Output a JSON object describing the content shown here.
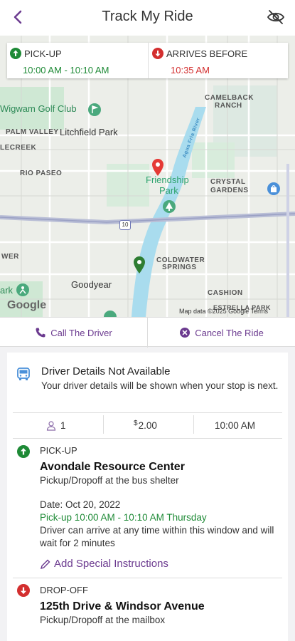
{
  "header": {
    "title": "Track My Ride"
  },
  "map": {
    "labels": {
      "wigwam": "Wigwam Golf Club",
      "palm_valley": "PALM VALLEY",
      "litchfield": "Litchfield Park",
      "lecreek": "LECREEK",
      "rio_paseo": "RIO PASEO",
      "camelback": "CAMELBACK",
      "ranch": "RANCH",
      "friendship": "Friendship",
      "park": "Park",
      "crystal": "CRYSTAL",
      "gardens": "GARDENS",
      "coldwater": "COLDWATER",
      "springs": "SPRINGS",
      "goodyear": "Goodyear",
      "cashion": "CASHION",
      "estrella": "ESTRELLA PARK",
      "wer": "WER",
      "ark": "ark",
      "agua_fria": "Agua Fria River",
      "i10": "10"
    },
    "google": "Google",
    "attribution": "Map data ©2025 Google   Terms"
  },
  "pickup_info": {
    "label": "PICK-UP",
    "value": "10:00 AM - 10:10 AM",
    "color": "#1e8a36"
  },
  "arrives_info": {
    "label": "ARRIVES BEFORE",
    "value": "10:35 AM",
    "color": "#d32f2f"
  },
  "actions": {
    "call": "Call The Driver",
    "cancel": "Cancel The Ride",
    "accent": "#6b3a8f"
  },
  "driver": {
    "title": "Driver Details Not Available",
    "subtitle": "Your driver details will be shown when your stop is next."
  },
  "stats": {
    "passengers": "1",
    "fare_symbol": "$",
    "fare": "2.00",
    "time": "10:00 AM"
  },
  "pickup": {
    "type": "PICK-UP",
    "name": "Avondale Resource Center",
    "note": "Pickup/Dropoff at the bus shelter",
    "date": "Date: Oct 20, 2022",
    "window": "Pick-up 10:00 AM - 10:10 AM Thursday",
    "wait_note": "Driver can arrive at any time within this window and will wait for 2 minutes",
    "add_instructions": "Add Special Instructions"
  },
  "dropoff": {
    "type": "DROP-OFF",
    "name": "125th Drive & Windsor Avenue",
    "note": "Pickup/Dropoff at the mailbox"
  }
}
